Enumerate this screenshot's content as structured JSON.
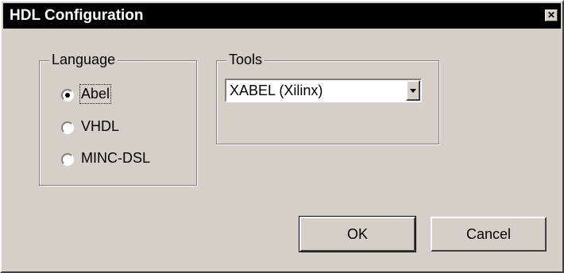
{
  "dialog": {
    "title": "HDL Configuration",
    "close_glyph": "✕"
  },
  "language_group": {
    "legend": "Language",
    "options": [
      {
        "label": "Abel",
        "selected": true
      },
      {
        "label": "VHDL",
        "selected": false
      },
      {
        "label": "MINC-DSL",
        "selected": false
      }
    ]
  },
  "tools_group": {
    "legend": "Tools",
    "select_value": "XABEL (Xilinx)"
  },
  "buttons": {
    "ok": "OK",
    "cancel": "Cancel"
  },
  "icons": {
    "close": "close-icon",
    "dropdown": "chevron-down-icon"
  }
}
